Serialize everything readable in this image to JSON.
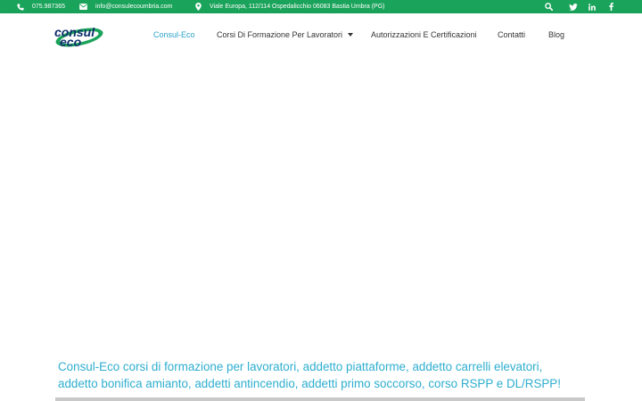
{
  "topbar": {
    "phone": "075.987365",
    "email": "info@consulecoumbria.com",
    "address": "Viale Europa, 112/114 Ospedalicchio 06083 Bastia Umbra (PG)"
  },
  "logo": {
    "line1": "consul",
    "line2": "eco"
  },
  "nav": {
    "items": [
      {
        "label": "Consul-Eco"
      },
      {
        "label": "Corsi Di Formazione Per Lavoratori"
      },
      {
        "label": "Autorizzazioni E Certificazioni"
      },
      {
        "label": "Contatti"
      },
      {
        "label": "Blog"
      }
    ]
  },
  "headline": {
    "line1": "Consul-Eco corsi di formazione per lavoratori, addetto piattaforme, addetto carrelli elevatori,",
    "line2": "addetto bonifica amianto, addetti antincendio, addetti primo soccorso, corso RSPP e DL/RSPP!"
  },
  "colors": {
    "topbar_bg": "#1aa35a",
    "accent": "#2aa3c7",
    "headline": "#2eaecf",
    "logo_ring": "#1aa35a",
    "logo_text": "#0f2f6b"
  },
  "icons": {
    "phone": "phone-icon",
    "email": "envelope-icon",
    "address": "map-marker-icon",
    "search": "search-icon",
    "twitter": "twitter-icon",
    "linkedin": "linkedin-icon",
    "facebook": "facebook-icon"
  }
}
